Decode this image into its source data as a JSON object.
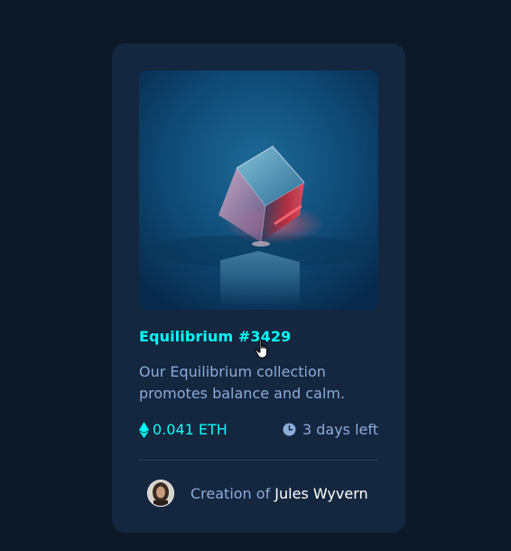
{
  "card": {
    "title": "Equilibrium #3429",
    "description": "Our Equilibrium collection promotes balance and calm.",
    "price": "0.041 ETH",
    "time_left": "3 days left",
    "creator_prefix": "Creation of ",
    "creator_name": "Jules Wyvern"
  },
  "icons": {
    "price": "ethereum-icon",
    "time": "clock-icon",
    "cursor": "hand-pointer-cursor"
  },
  "colors": {
    "background": "#0d1829",
    "card": "#15263f",
    "accent": "#00fff8",
    "soft_blue": "#8bacd9",
    "divider": "#2e405a",
    "white": "#ffffff"
  }
}
